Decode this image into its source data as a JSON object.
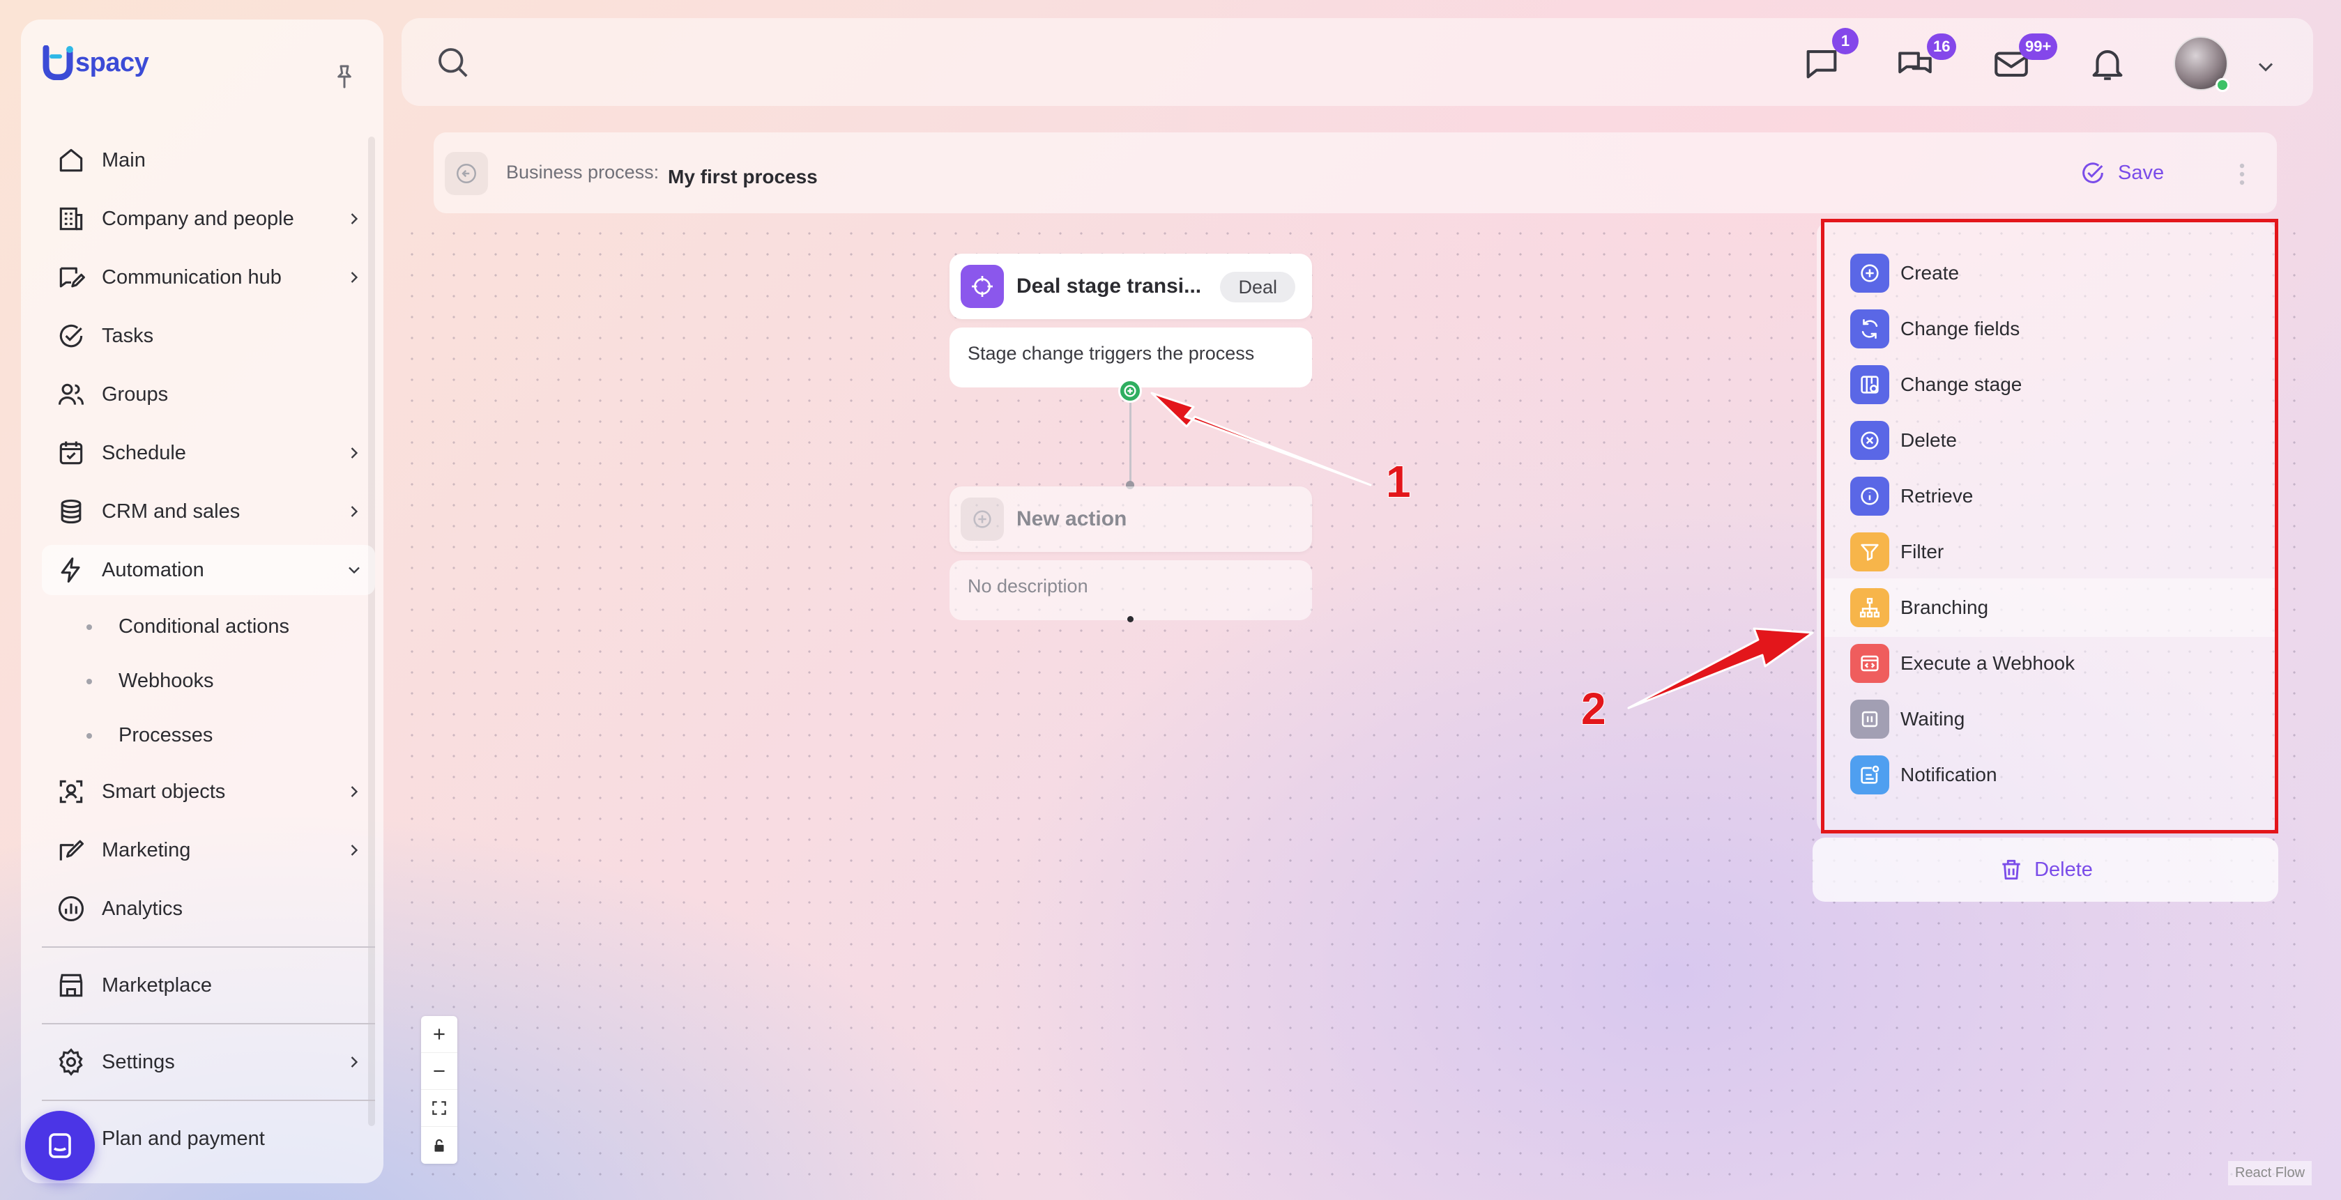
{
  "sidebar": {
    "logo_text": "spacy",
    "items": [
      {
        "label": "Main",
        "icon": "home-icon"
      },
      {
        "label": "Company and people",
        "icon": "building-icon"
      },
      {
        "label": "Communication hub",
        "icon": "chat-edit-icon"
      },
      {
        "label": "Tasks",
        "icon": "check-circle-icon"
      },
      {
        "label": "Groups",
        "icon": "users-icon"
      },
      {
        "label": "Schedule",
        "icon": "calendar-icon"
      },
      {
        "label": "CRM and sales",
        "icon": "coins-icon"
      },
      {
        "label": "Automation",
        "icon": "lightning-icon"
      },
      {
        "label": "Smart objects",
        "icon": "smart-object-icon"
      },
      {
        "label": "Marketing",
        "icon": "marketing-icon"
      },
      {
        "label": "Analytics",
        "icon": "chart-icon"
      },
      {
        "label": "Marketplace",
        "icon": "store-icon"
      },
      {
        "label": "Settings",
        "icon": "gear-icon"
      },
      {
        "label": "Plan and payment",
        "icon": "wallet-icon"
      }
    ],
    "automation_sub": [
      "Conditional actions",
      "Webhooks",
      "Processes"
    ]
  },
  "topbar": {
    "badges": {
      "messages": "1",
      "chats": "16",
      "mail": "99+"
    }
  },
  "breadcrumb": {
    "label": "Business process:",
    "value": "My first process",
    "save_label": "Save"
  },
  "canvas": {
    "trigger": {
      "title": "Deal stage transi...",
      "chip": "Deal",
      "description": "Stage change triggers the process"
    },
    "new_action": {
      "title": "New action",
      "description": "No description"
    },
    "attribution": "React Flow"
  },
  "action_menu": {
    "items": [
      {
        "label": "Create",
        "color": "#5a67e6",
        "icon": "plus-circle-icon"
      },
      {
        "label": "Change fields",
        "color": "#5a67e6",
        "icon": "refresh-icon"
      },
      {
        "label": "Change stage",
        "color": "#5a67e6",
        "icon": "stage-icon"
      },
      {
        "label": "Delete",
        "color": "#5a67e6",
        "icon": "x-circle-icon"
      },
      {
        "label": "Retrieve",
        "color": "#5a67e6",
        "icon": "info-icon"
      },
      {
        "label": "Filter",
        "color": "#f7b54a",
        "icon": "funnel-icon"
      },
      {
        "label": "Branching",
        "color": "#f7b54a",
        "icon": "branch-icon"
      },
      {
        "label": "Execute a Webhook",
        "color": "#ef5d5d",
        "icon": "webhook-icon"
      },
      {
        "label": "Waiting",
        "color": "#a29fb3",
        "icon": "pause-icon"
      },
      {
        "label": "Notification",
        "color": "#4f9ff0",
        "icon": "notification-icon"
      }
    ],
    "delete_label": "Delete"
  },
  "annotations": {
    "one": "1",
    "two": "2"
  },
  "colors": {
    "accent": "#7a4ce9",
    "badge": "#8447ea",
    "annotation": "#e3161b",
    "trigger_icon": "#8b57ec"
  }
}
